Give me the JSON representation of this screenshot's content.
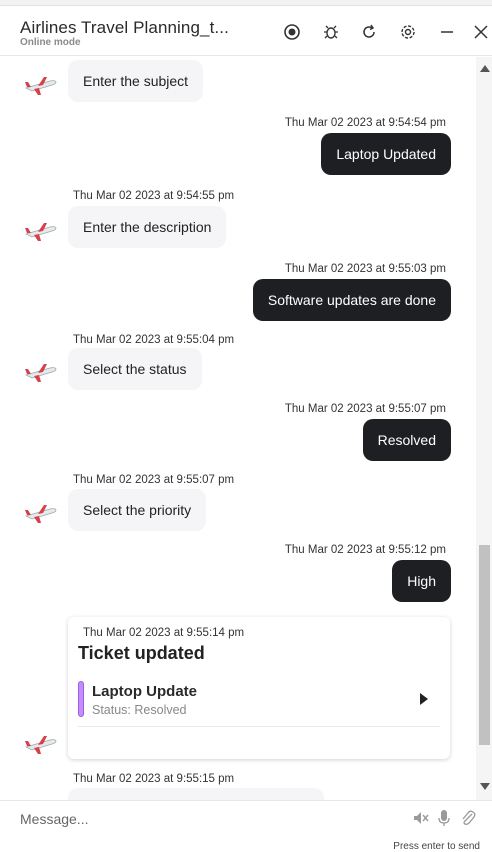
{
  "header": {
    "title": "Airlines Travel Planning_t...",
    "subtitle": "Online mode",
    "icons": [
      "record-icon",
      "bug-icon",
      "refresh-icon",
      "settings-icon",
      "minimize-icon",
      "close-icon"
    ]
  },
  "messages": [
    {
      "from": "bot",
      "timestamp": "",
      "text": "Enter the subject"
    },
    {
      "from": "user",
      "timestamp": "Thu Mar 02 2023 at 9:54:54 pm",
      "text": "Laptop Updated"
    },
    {
      "from": "bot",
      "timestamp": "Thu Mar 02 2023 at 9:54:55 pm",
      "text": "Enter the description"
    },
    {
      "from": "user",
      "timestamp": "Thu Mar 02 2023 at 9:55:03 pm",
      "text": "Software updates are done"
    },
    {
      "from": "bot",
      "timestamp": "Thu Mar 02 2023 at 9:55:04 pm",
      "text": "Select the status"
    },
    {
      "from": "user",
      "timestamp": "Thu Mar 02 2023 at 9:55:07 pm",
      "text": "Resolved"
    },
    {
      "from": "bot",
      "timestamp": "Thu Mar 02 2023 at 9:55:07 pm",
      "text": "Select the priority"
    },
    {
      "from": "user",
      "timestamp": "Thu Mar 02 2023 at 9:55:12 pm",
      "text": "High"
    }
  ],
  "card": {
    "timestamp": "Thu Mar 02 2023 at 9:55:14 pm",
    "title": "Ticket updated",
    "item_title": "Laptop Update",
    "item_status": "Status: Resolved",
    "accent_color": "#c48cff"
  },
  "last_timestamp": "Thu Mar 02 2023 at 9:55:15 pm",
  "composer": {
    "placeholder": "Message...",
    "hint": "Press enter to send",
    "icons": [
      "speaker-muted-icon",
      "microphone-icon",
      "attachment-icon"
    ]
  },
  "colors": {
    "user_bubble": "#1e1f22",
    "bot_bubble": "#f5f5f7"
  }
}
